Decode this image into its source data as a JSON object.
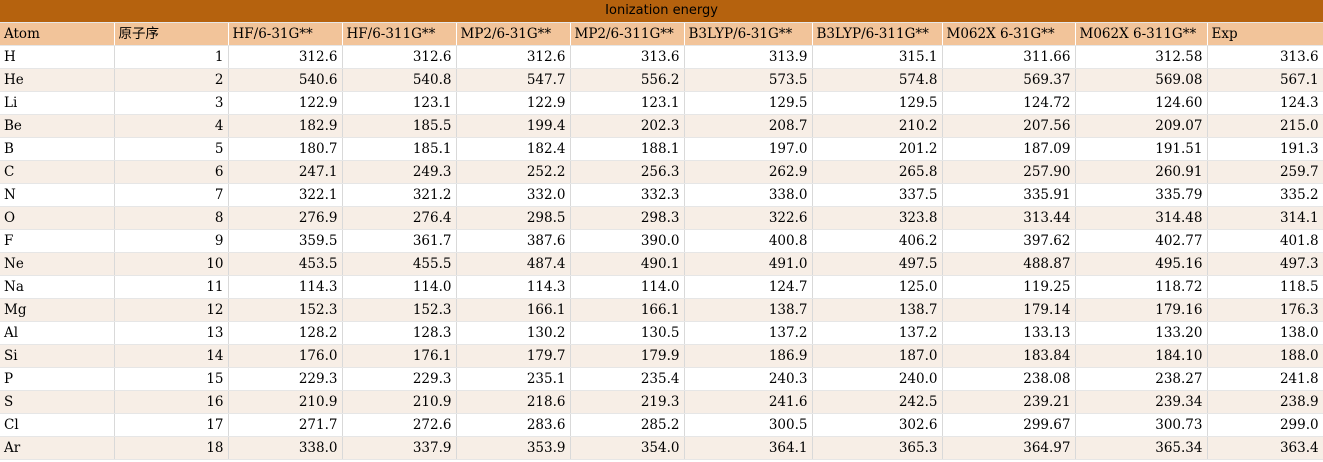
{
  "table": {
    "title": "Ionization energy",
    "headers": [
      "Atom",
      "原子序",
      "HF/6-31G**",
      "HF/6-311G**",
      "MP2/6-31G**",
      "MP2/6-311G**",
      "B3LYP/6-31G**",
      "B3LYP/6-311G**",
      "M062X 6-31G**",
      "M062X 6-311G**",
      "Exp"
    ],
    "rows": [
      [
        "H",
        "1",
        "312.6",
        "312.6",
        "312.6",
        "313.6",
        "313.9",
        "315.1",
        "311.66",
        "312.58",
        "313.6"
      ],
      [
        "He",
        "2",
        "540.6",
        "540.8",
        "547.7",
        "556.2",
        "573.5",
        "574.8",
        "569.37",
        "569.08",
        "567.1"
      ],
      [
        "Li",
        "3",
        "122.9",
        "123.1",
        "122.9",
        "123.1",
        "129.5",
        "129.5",
        "124.72",
        "124.60",
        "124.3"
      ],
      [
        "Be",
        "4",
        "182.9",
        "185.5",
        "199.4",
        "202.3",
        "208.7",
        "210.2",
        "207.56",
        "209.07",
        "215.0"
      ],
      [
        "B",
        "5",
        "180.7",
        "185.1",
        "182.4",
        "188.1",
        "197.0",
        "201.2",
        "187.09",
        "191.51",
        "191.3"
      ],
      [
        "C",
        "6",
        "247.1",
        "249.3",
        "252.2",
        "256.3",
        "262.9",
        "265.8",
        "257.90",
        "260.91",
        "259.7"
      ],
      [
        "N",
        "7",
        "322.1",
        "321.2",
        "332.0",
        "332.3",
        "338.0",
        "337.5",
        "335.91",
        "335.79",
        "335.2"
      ],
      [
        "O",
        "8",
        "276.9",
        "276.4",
        "298.5",
        "298.3",
        "322.6",
        "323.8",
        "313.44",
        "314.48",
        "314.1"
      ],
      [
        "F",
        "9",
        "359.5",
        "361.7",
        "387.6",
        "390.0",
        "400.8",
        "406.2",
        "397.62",
        "402.77",
        "401.8"
      ],
      [
        "Ne",
        "10",
        "453.5",
        "455.5",
        "487.4",
        "490.1",
        "491.0",
        "497.5",
        "488.87",
        "495.16",
        "497.3"
      ],
      [
        "Na",
        "11",
        "114.3",
        "114.0",
        "114.3",
        "114.0",
        "124.7",
        "125.0",
        "119.25",
        "118.72",
        "118.5"
      ],
      [
        "Mg",
        "12",
        "152.3",
        "152.3",
        "166.1",
        "166.1",
        "138.7",
        "138.7",
        "179.14",
        "179.16",
        "176.3"
      ],
      [
        "Al",
        "13",
        "128.2",
        "128.3",
        "130.2",
        "130.5",
        "137.2",
        "137.2",
        "133.13",
        "133.20",
        "138.0"
      ],
      [
        "Si",
        "14",
        "176.0",
        "176.1",
        "179.7",
        "179.9",
        "186.9",
        "187.0",
        "183.84",
        "184.10",
        "188.0"
      ],
      [
        "P",
        "15",
        "229.3",
        "229.3",
        "235.1",
        "235.4",
        "240.3",
        "240.0",
        "238.08",
        "238.27",
        "241.8"
      ],
      [
        "S",
        "16",
        "210.9",
        "210.9",
        "218.6",
        "219.3",
        "241.6",
        "242.5",
        "239.21",
        "239.34",
        "238.9"
      ],
      [
        "Cl",
        "17",
        "271.7",
        "272.6",
        "283.6",
        "285.2",
        "300.5",
        "302.6",
        "299.67",
        "300.73",
        "299.0"
      ],
      [
        "Ar",
        "18",
        "338.0",
        "337.9",
        "353.9",
        "354.0",
        "364.1",
        "365.3",
        "364.97",
        "365.34",
        "363.4"
      ]
    ]
  }
}
